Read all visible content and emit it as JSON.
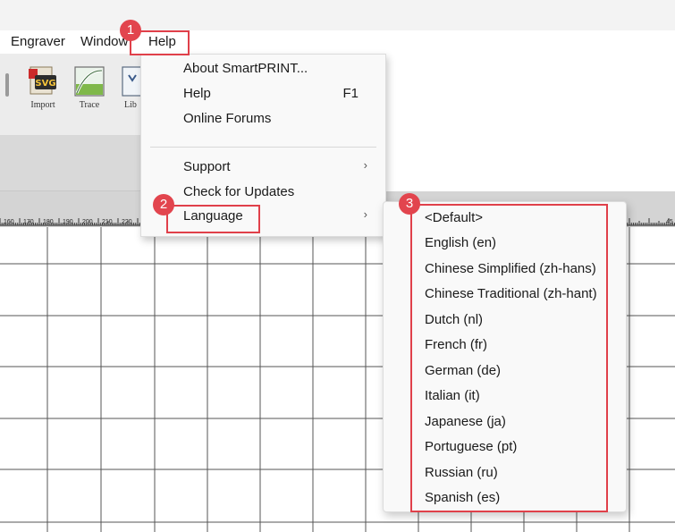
{
  "menubar": {
    "items": [
      {
        "label": "Engraver"
      },
      {
        "label": "Window"
      },
      {
        "label": "Help"
      }
    ]
  },
  "toolbar": {
    "buttons": [
      {
        "label": "Import",
        "icon": "svg-import-icon"
      },
      {
        "label": "Trace",
        "icon": "trace-icon"
      },
      {
        "label": "Lib",
        "icon": "library-icon"
      }
    ]
  },
  "ruler": {
    "labels": [
      "160",
      "170",
      "180",
      "190",
      "200",
      "210",
      "220"
    ],
    "right_label": "45"
  },
  "help_menu": {
    "items": [
      {
        "label": "About SmartPRINT...",
        "shortcut": ""
      },
      {
        "label": "Help",
        "shortcut": "F1"
      },
      {
        "label": "Online Forums",
        "shortcut": ""
      },
      {
        "label": "Support",
        "submenu_arrow": "›"
      },
      {
        "label": "Check for Updates",
        "shortcut": ""
      },
      {
        "label": "Language",
        "submenu_arrow": "›"
      }
    ]
  },
  "language_menu": {
    "items": [
      {
        "label": "<Default>"
      },
      {
        "label": "English (en)"
      },
      {
        "label": "Chinese Simplified (zh-hans)"
      },
      {
        "label": "Chinese Traditional (zh-hant)"
      },
      {
        "label": "Dutch (nl)"
      },
      {
        "label": "French (fr)"
      },
      {
        "label": "German (de)"
      },
      {
        "label": "Italian (it)"
      },
      {
        "label": "Japanese (ja)"
      },
      {
        "label": "Portuguese (pt)"
      },
      {
        "label": "Russian (ru)"
      },
      {
        "label": "Spanish (es)"
      }
    ]
  },
  "annotations": {
    "step1": "1",
    "step2": "2",
    "step3": "3",
    "highlight_color": "#e0404a"
  }
}
